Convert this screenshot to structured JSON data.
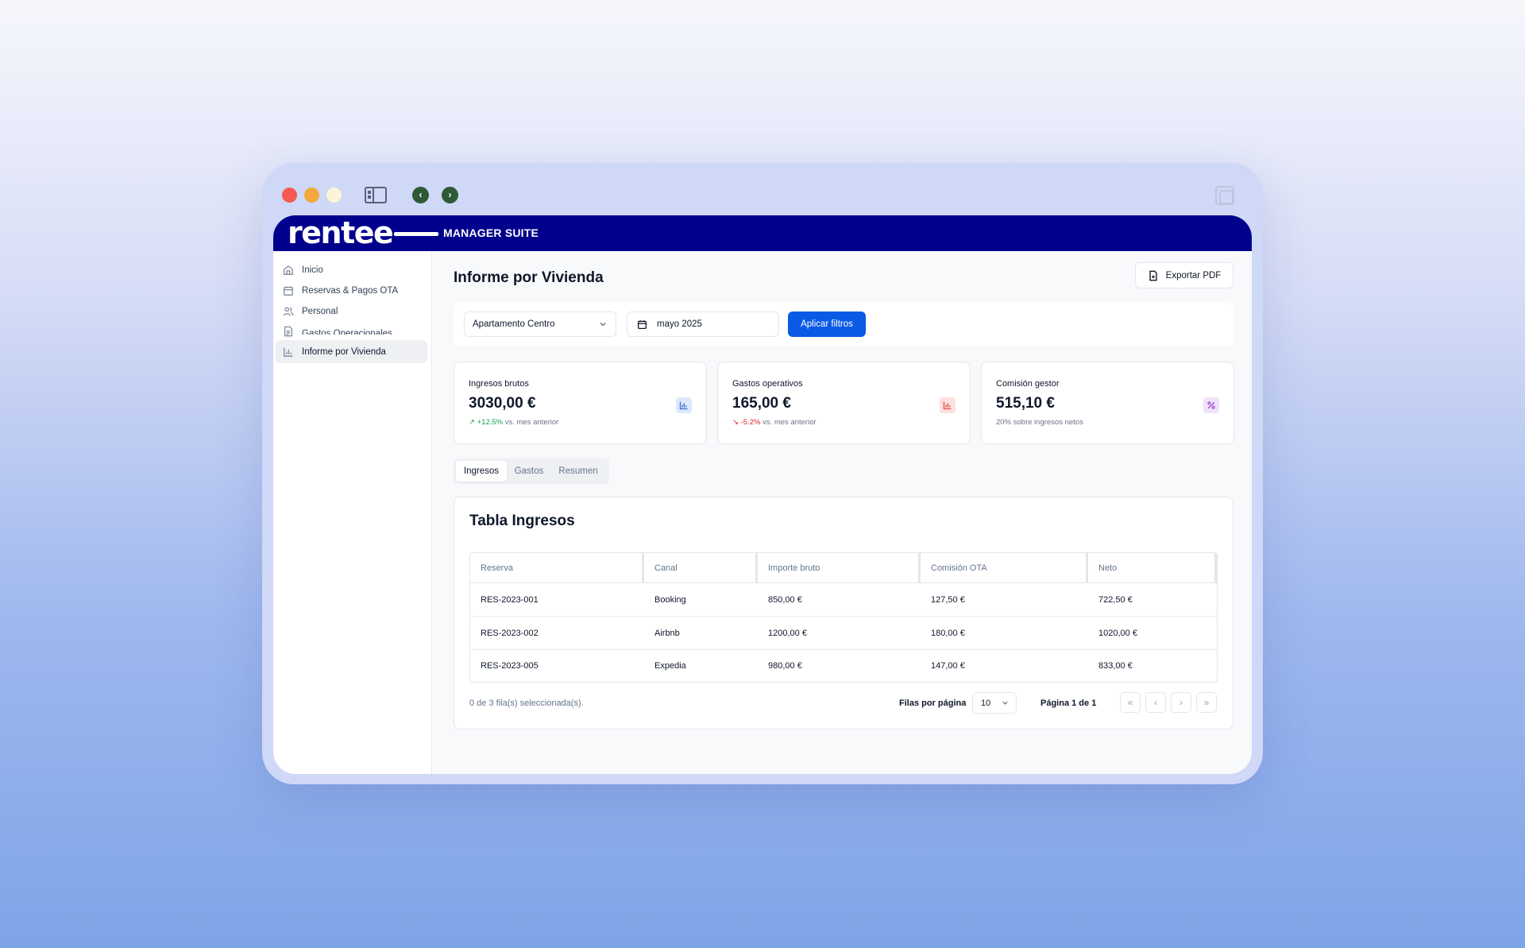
{
  "window": {
    "back_glyph": "‹",
    "forward_glyph": "›"
  },
  "brand": {
    "logo": "rentee",
    "suite": "MANAGER SUITE"
  },
  "sidebar": {
    "items": [
      {
        "label": "Inicio",
        "icon": "home-icon"
      },
      {
        "label": "Reservas & Pagos OTA",
        "icon": "calendar-icon"
      },
      {
        "label": "Personal",
        "icon": "users-icon"
      },
      {
        "label": "Gastos Operacionales",
        "icon": "document-icon"
      },
      {
        "label": "Informe por Vivienda",
        "icon": "bar-chart-icon",
        "active": true
      }
    ]
  },
  "header": {
    "title": "Informe por Vivienda",
    "export_label": "Exportar PDF"
  },
  "filters": {
    "property": "Apartamento Centro",
    "month": "mayo 2025",
    "apply_label": "Aplicar filtros"
  },
  "stats": [
    {
      "title": "Ingresos brutos",
      "value": "3030,00 €",
      "delta": "+12.5%",
      "delta_arrow": "↗",
      "sub": " vs. mes anterior",
      "icon": "bar-chart-icon",
      "color": "#3b6fd6"
    },
    {
      "title": "Gastos operativos",
      "value": "165,00 €",
      "delta": "-5.2%",
      "delta_arrow": "↘",
      "sub": " vs. mes anterior",
      "icon": "bar-chart-icon",
      "color": "#e05151"
    },
    {
      "title": "Comisión gestor",
      "value": "515,10 €",
      "sub": "20% sobre ingresos netos",
      "icon": "percent-icon",
      "color": "#9b4fd4"
    }
  ],
  "tabs": [
    "Ingresos",
    "Gastos",
    "Resumen"
  ],
  "table": {
    "title": "Tabla Ingresos",
    "columns": [
      "Reserva",
      "Canal",
      "Importe bruto",
      "Comisión OTA",
      "Neto"
    ],
    "rows": [
      [
        "RES-2023-001",
        "Booking",
        "850,00 €",
        "127,50 €",
        "722,50 €"
      ],
      [
        "RES-2023-002",
        "Airbnb",
        "1200,00 €",
        "180,00 €",
        "1020,00 €"
      ],
      [
        "RES-2023-005",
        "Expedia",
        "980,00 €",
        "147,00 €",
        "833,00 €"
      ]
    ],
    "selection": "0 de 3 fila(s) seleccionada(s).",
    "rows_per_page_label": "Filas por página",
    "rows_per_page": "10",
    "page_info": "Página 1 de 1",
    "pager": {
      "first": "«",
      "prev": "‹",
      "next": "›",
      "last": "»"
    }
  }
}
